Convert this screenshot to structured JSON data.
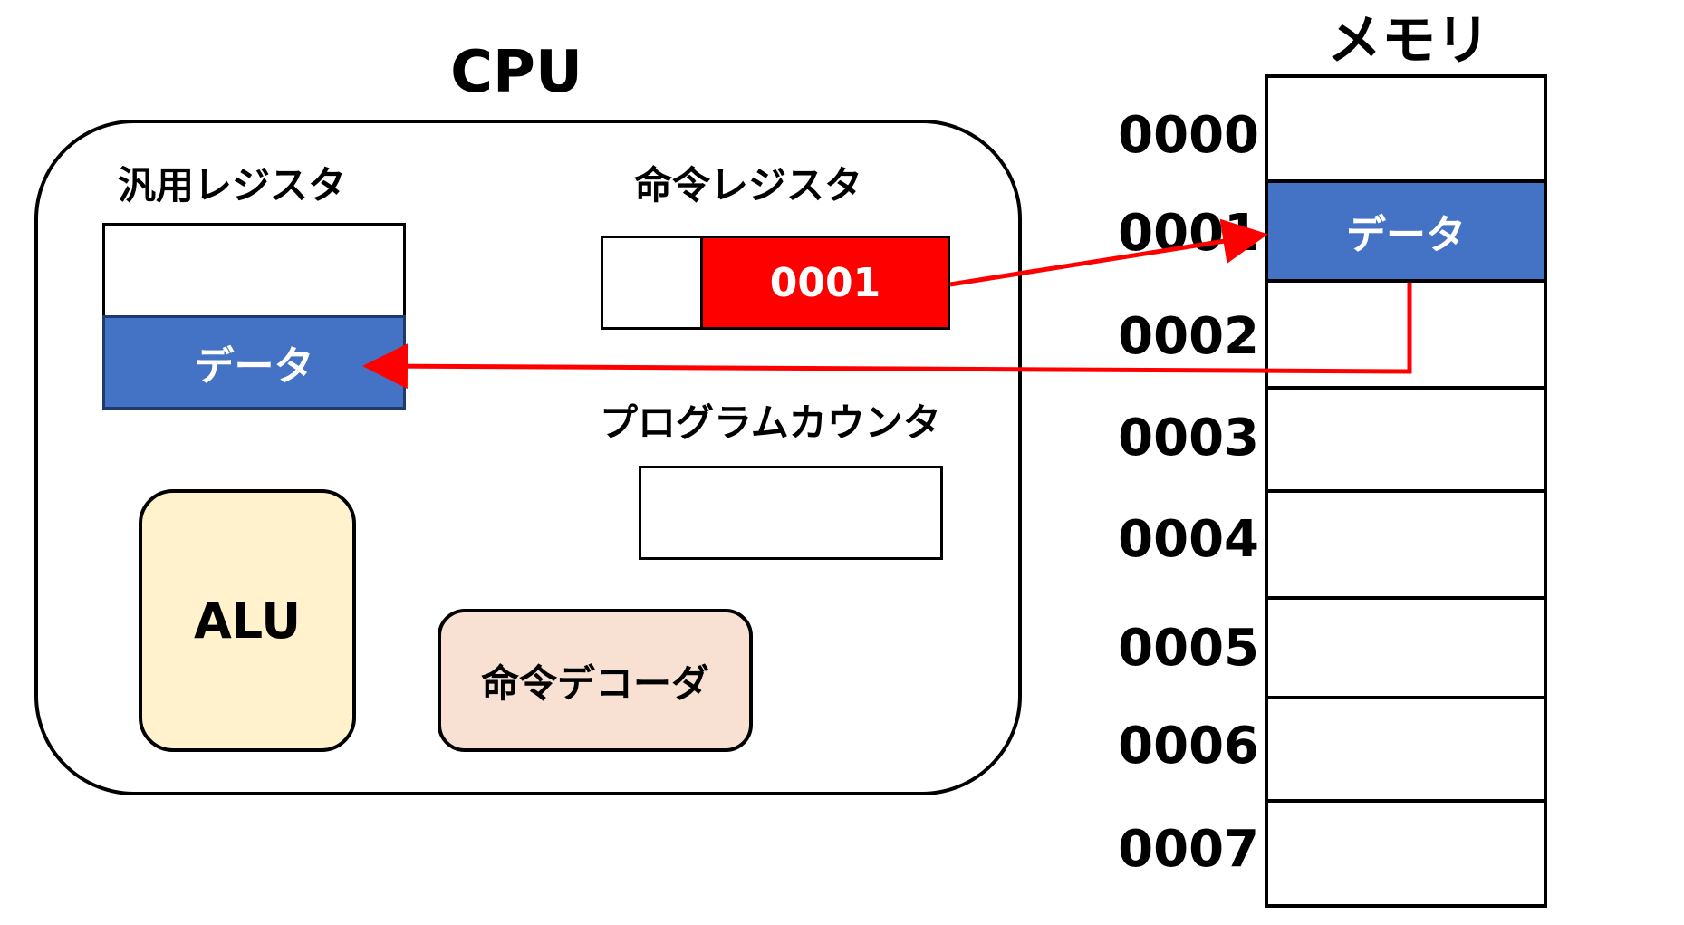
{
  "colors": {
    "data_blue": "#4472c4",
    "address_red": "#ff0000",
    "arrow_red": "#ff0000",
    "alu_fill": "#fff2cc",
    "decoder_fill": "#f8e0d2"
  },
  "cpu": {
    "title": "CPU",
    "general_register": {
      "label": "汎用レジスタ",
      "data_label": "データ"
    },
    "instruction_register": {
      "label": "命令レジスタ",
      "operand_value": "0001"
    },
    "program_counter": {
      "label": "プログラムカウンタ"
    },
    "alu": {
      "label": "ALU"
    },
    "instruction_decoder": {
      "label": "命令デコーダ"
    }
  },
  "memory": {
    "title": "メモリ",
    "addresses": [
      "0000",
      "0001",
      "0002",
      "0003",
      "0004",
      "0005",
      "0006",
      "0007"
    ],
    "data_label": "データ",
    "data_address": "0001"
  },
  "arrows": [
    {
      "from": "instruction-register-operand",
      "to": "memory-cell-0001"
    },
    {
      "from": "memory-cell-0001",
      "to": "general-register-data"
    }
  ]
}
